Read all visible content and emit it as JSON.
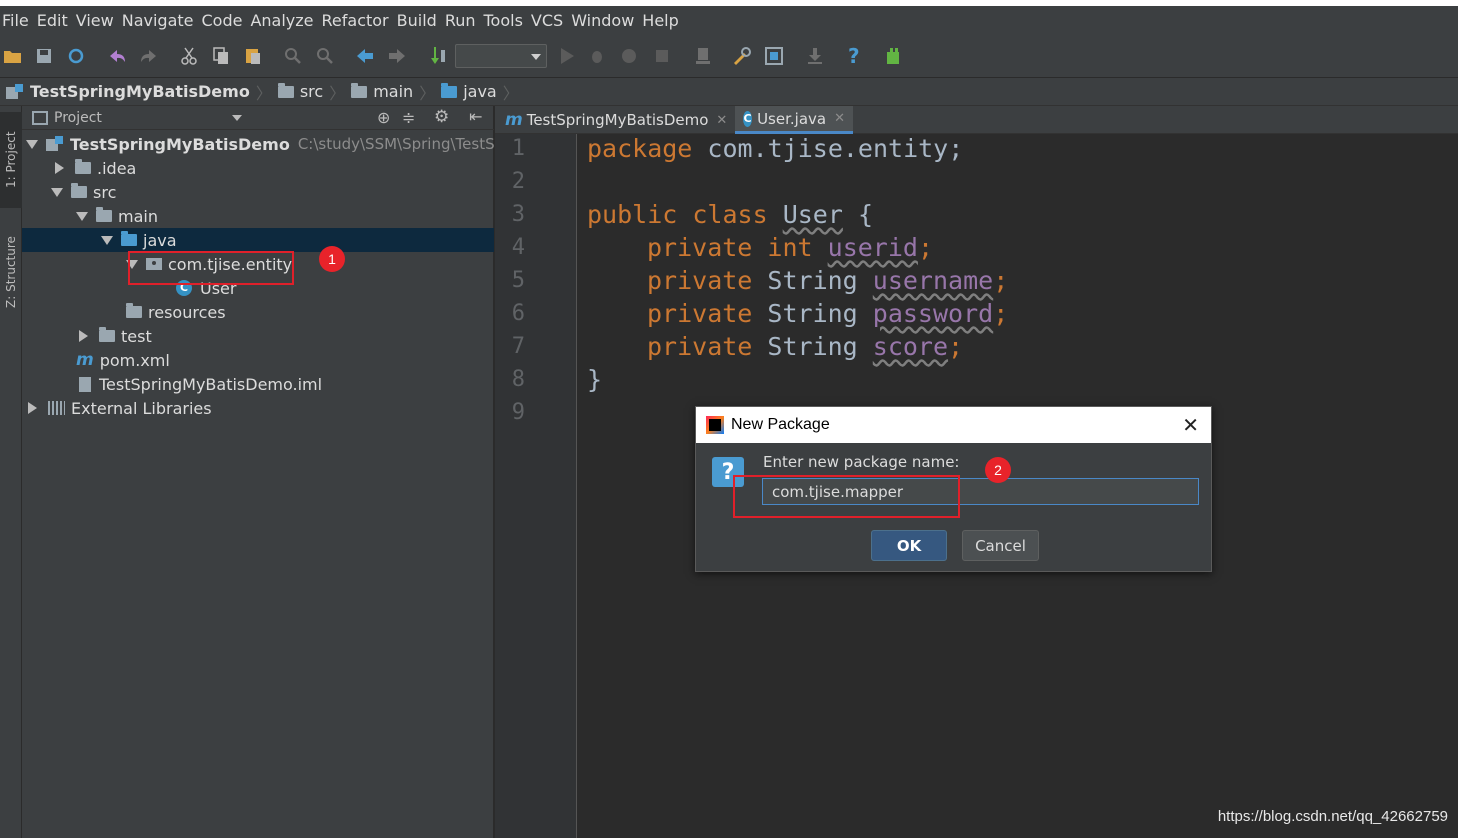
{
  "menu": [
    "File",
    "Edit",
    "View",
    "Navigate",
    "Code",
    "Analyze",
    "Refactor",
    "Build",
    "Run",
    "Tools",
    "VCS",
    "Window",
    "Help"
  ],
  "breadcrumb": [
    "TestSpringMyBatisDemo",
    "src",
    "main",
    "java"
  ],
  "side_tabs": {
    "project": "1: Project",
    "structure": "Z: Structure"
  },
  "project_panel": {
    "title": "Project",
    "root_name": "TestSpringMyBatisDemo",
    "root_path": "C:\\study\\SSM\\Spring\\TestSprin",
    "items": {
      "idea": ".idea",
      "src": "src",
      "main": "main",
      "java": "java",
      "entity_pkg": "com.tjise.entity",
      "user_class": "User",
      "resources": "resources",
      "test": "test",
      "pom": "pom.xml",
      "iml": "TestSpringMyBatisDemo.iml",
      "ext_libs": "External Libraries"
    }
  },
  "annotations": {
    "badge1": "1",
    "badge2": "2"
  },
  "editor": {
    "tabs": [
      {
        "label": "TestSpringMyBatisDemo",
        "icon": "maven-m-icon"
      },
      {
        "label": "User.java",
        "icon": "class-c-icon",
        "active": true
      }
    ],
    "line_numbers": [
      "1",
      "2",
      "3",
      "4",
      "5",
      "6",
      "7",
      "8",
      "9"
    ],
    "code": {
      "l1_kw": "package",
      "l1_rest": " com.tjise.entity;",
      "l3_kw": "public class",
      "l3_name": "User",
      "l3_brace": " {",
      "l4_kw": "private int",
      "l4_field": "userid",
      "l5_kw": "private",
      "l5_type": " String ",
      "l5_field": "username",
      "l6_kw": "private",
      "l6_type": " String ",
      "l6_field": "password",
      "l7_kw": "private",
      "l7_type": " String ",
      "l7_field": "score",
      "semi": ";",
      "l8": "}"
    }
  },
  "dialog": {
    "title": "New Package",
    "label": "Enter new package name:",
    "value": "com.tjise.mapper",
    "ok": "OK",
    "cancel": "Cancel",
    "close": "✕"
  },
  "watermark": "https://blog.csdn.net/qq_42662759"
}
